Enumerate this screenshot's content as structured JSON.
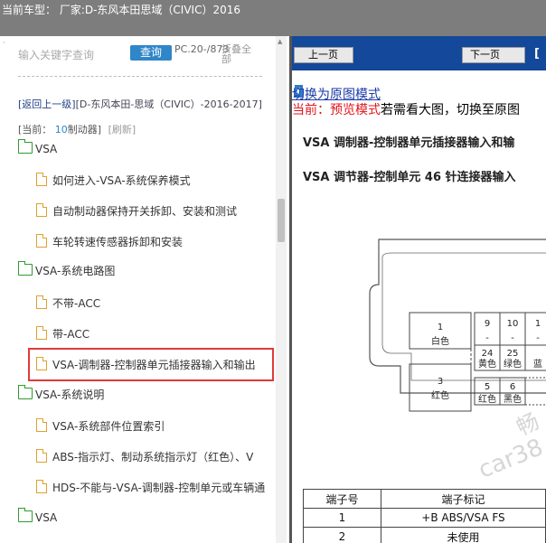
{
  "header": {
    "vehicle_label": "当前车型：  厂家:D-东风本田思域（CIVIC）2016"
  },
  "left": {
    "dot": "·",
    "search_placeholder": "输入关键字查询",
    "search_button": "查询",
    "pc_info": "PC.20-/873",
    "collapse_all": "折叠全部",
    "breadcrumb_back": "[返回上一级]",
    "breadcrumb_path": "[D-东风本田-思域（CIVIC）-2016-2017]",
    "current_label": "[当前：",
    "current_num": "10",
    "current_name": "制动器]",
    "refresh": "[刷新]",
    "tree": [
      {
        "type": "folder",
        "label": "VSA"
      },
      {
        "type": "doc",
        "label": "如何进入-VSA-系统保养模式"
      },
      {
        "type": "doc",
        "label": "自动制动器保持开关拆卸、安装和测试"
      },
      {
        "type": "doc",
        "label": "车轮转速传感器拆卸和安装"
      },
      {
        "type": "folder",
        "label": "VSA-系统电路图"
      },
      {
        "type": "doc",
        "label": "不带-ACC"
      },
      {
        "type": "doc",
        "label": "带-ACC"
      },
      {
        "type": "doc",
        "label": "VSA-调制器-控制器单元插接器输入和输出"
      },
      {
        "type": "folder",
        "label": "VSA-系统说明"
      },
      {
        "type": "doc",
        "label": "VSA-系统部件位置索引"
      },
      {
        "type": "doc",
        "label": "ABS-指示灯、制动系统指示灯（红色）、V"
      },
      {
        "type": "doc",
        "label": "HDS-不能与-VSA-调制器-控制单元或车辆通"
      },
      {
        "type": "folder",
        "label": "VSA"
      }
    ]
  },
  "right": {
    "prev_button": "上一页",
    "next_button": "下一页",
    "nav_extra": "[",
    "switch_link": "切换为原图模式",
    "preview_prefix": "当前：预览模式",
    "preview_suffix": "若需看大图，切换至原图",
    "doc_title1": "VSA 调制器-控制器单元插接器输入和输",
    "doc_title2": "VSA 调节器-控制单元 46 针连接器输入",
    "connector": {
      "pin1": "1",
      "pin1_color": "白色",
      "pin3": "3",
      "pin3_color": "红色",
      "pin9": "9",
      "pin10": "10",
      "pin11": "1",
      "dash1": "-",
      "dash2": "-",
      "dash3": "-",
      "pin24": "24",
      "pin24_color": "黄色",
      "pin25": "25",
      "pin25_color": "绿色",
      "pin26_color": "蓝",
      "pin5": "5",
      "pin5_color": "红色",
      "pin6": "6",
      "pin6_color": "黑色"
    },
    "watermark1": "畅",
    "watermark2": "car38",
    "table": {
      "headers": [
        "端子号",
        "端子标记"
      ],
      "rows": [
        [
          "1",
          "+B ABS/VSA FS"
        ],
        [
          "2",
          "未使用"
        ]
      ]
    }
  }
}
